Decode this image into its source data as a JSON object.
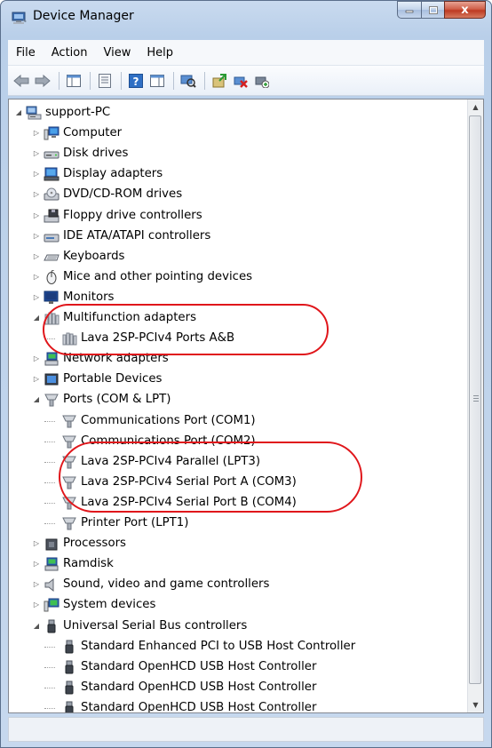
{
  "window": {
    "title": "Device Manager",
    "close_glyph": "x"
  },
  "menu": [
    {
      "name": "menu-file",
      "label": "File"
    },
    {
      "name": "menu-action",
      "label": "Action"
    },
    {
      "name": "menu-view",
      "label": "View"
    },
    {
      "name": "menu-help",
      "label": "Help"
    }
  ],
  "toolbar": {
    "buttons": [
      "back-arrow-icon",
      "forward-arrow-icon",
      "show-hide-console-tree-icon",
      "properties-icon",
      "help-icon",
      "action-pane-icon",
      "scan-hardware-icon",
      "update-driver-icon",
      "disable-device-icon",
      "uninstall-device-icon"
    ]
  },
  "tree": [
    {
      "label": "support-PC",
      "expanded": true,
      "has_children": true,
      "icon": "computer-root-icon"
    },
    {
      "label": "Computer",
      "expanded": false,
      "has_children": true,
      "icon": "computer-icon"
    },
    {
      "label": "Disk drives",
      "expanded": false,
      "has_children": true,
      "icon": "disk-drive-icon"
    },
    {
      "label": "Display adapters",
      "expanded": false,
      "has_children": true,
      "icon": "display-adapter-icon"
    },
    {
      "label": "DVD/CD-ROM drives",
      "expanded": false,
      "has_children": true,
      "icon": "dvd-drive-icon"
    },
    {
      "label": "Floppy drive controllers",
      "expanded": false,
      "has_children": true,
      "icon": "floppy-controller-icon"
    },
    {
      "label": "IDE ATA/ATAPI controllers",
      "expanded": false,
      "has_children": true,
      "icon": "ide-controller-icon"
    },
    {
      "label": "Keyboards",
      "expanded": false,
      "has_children": true,
      "icon": "keyboard-icon"
    },
    {
      "label": "Mice and other pointing devices",
      "expanded": false,
      "has_children": true,
      "icon": "mouse-icon"
    },
    {
      "label": "Monitors",
      "expanded": false,
      "has_children": true,
      "icon": "monitor-icon"
    },
    {
      "label": "Multifunction adapters",
      "expanded": true,
      "has_children": true,
      "icon": "multifunction-adapter-icon"
    },
    {
      "label": "Lava 2SP-PCIv4 Ports A&B",
      "has_children": false,
      "icon": "multifunction-adapter-icon"
    },
    {
      "label": "Network adapters",
      "expanded": false,
      "has_children": true,
      "icon": "network-adapter-icon"
    },
    {
      "label": "Portable Devices",
      "expanded": false,
      "has_children": true,
      "icon": "portable-device-icon"
    },
    {
      "label": "Ports (COM & LPT)",
      "expanded": true,
      "has_children": true,
      "icon": "port-icon"
    },
    {
      "label": "Communications Port (COM1)",
      "has_children": false,
      "icon": "port-icon"
    },
    {
      "label": "Communications Port (COM2)",
      "has_children": false,
      "icon": "port-icon"
    },
    {
      "label": "Lava 2SP-PCIv4 Parallel (LPT3)",
      "has_children": false,
      "icon": "port-icon"
    },
    {
      "label": "Lava 2SP-PCIv4 Serial Port A (COM3)",
      "has_children": false,
      "icon": "port-icon"
    },
    {
      "label": "Lava 2SP-PCIv4 Serial Port B (COM4)",
      "has_children": false,
      "icon": "port-icon"
    },
    {
      "label": "Printer Port (LPT1)",
      "has_children": false,
      "icon": "port-icon"
    },
    {
      "label": "Processors",
      "expanded": false,
      "has_children": true,
      "icon": "processor-icon"
    },
    {
      "label": "Ramdisk",
      "expanded": false,
      "has_children": true,
      "icon": "ramdisk-icon"
    },
    {
      "label": "Sound, video and game controllers",
      "expanded": false,
      "has_children": true,
      "icon": "sound-icon"
    },
    {
      "label": "System devices",
      "expanded": false,
      "has_children": true,
      "icon": "system-device-icon"
    },
    {
      "label": "Universal Serial Bus controllers",
      "expanded": true,
      "has_children": true,
      "icon": "usb-icon"
    },
    {
      "label": "Standard Enhanced PCI to USB Host Controller",
      "has_children": false,
      "icon": "usb-icon"
    },
    {
      "label": "Standard OpenHCD USB Host Controller",
      "has_children": false,
      "icon": "usb-icon"
    },
    {
      "label": "Standard OpenHCD USB Host Controller",
      "has_children": false,
      "icon": "usb-icon"
    },
    {
      "label": "Standard OpenHCD USB Host Controller",
      "has_children": false,
      "icon": "usb-icon"
    }
  ],
  "colors": {
    "highlight": "#e0161b",
    "title_bar": "#c9daef",
    "close_button": "#c7452c"
  }
}
